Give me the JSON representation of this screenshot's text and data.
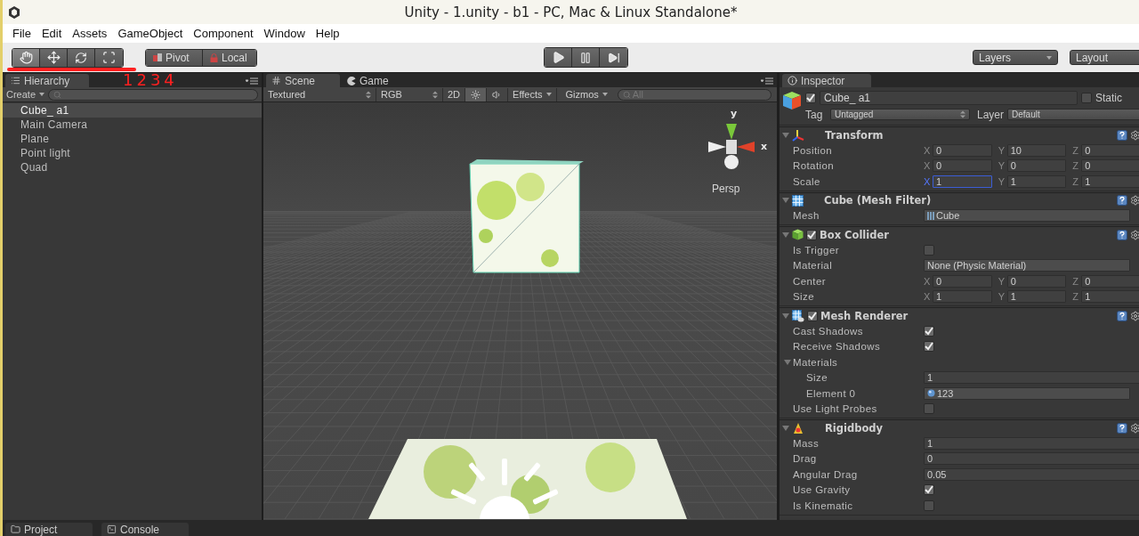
{
  "window": {
    "title": "Unity - 1.unity - b1 - PC, Mac & Linux Standalone*"
  },
  "menu": [
    "File",
    "Edit",
    "Assets",
    "GameObject",
    "Component",
    "Window",
    "Help"
  ],
  "toolbar": {
    "tools": [
      {
        "kind": "hand",
        "selected": true
      },
      {
        "kind": "move",
        "selected": false
      },
      {
        "kind": "rotate",
        "selected": false
      },
      {
        "kind": "scale",
        "selected": false
      }
    ],
    "pivot": "Pivot",
    "local": "Local",
    "playback": [
      {
        "kind": "play"
      },
      {
        "kind": "pause"
      },
      {
        "kind": "step"
      }
    ],
    "layers": "Layers",
    "layout": "Layout"
  },
  "annotation": {
    "text": "1234"
  },
  "hierarchy": {
    "tab": "Hierarchy",
    "create": "Create",
    "items": [
      {
        "label": "Cube_ a1",
        "selected": true
      },
      {
        "label": "Main Camera",
        "selected": false
      },
      {
        "label": "Plane",
        "selected": false
      },
      {
        "label": "Point light",
        "selected": false
      },
      {
        "label": "Quad",
        "selected": false
      }
    ]
  },
  "scene": {
    "tabs": [
      {
        "label": "Scene",
        "kind": "scene",
        "selected": true
      },
      {
        "label": "Game",
        "kind": "game",
        "selected": false
      }
    ],
    "toolbar": {
      "draw_mode": "Textured",
      "render_mode": "RGB",
      "mode_2d": {
        "label": "2D",
        "on": false
      },
      "lighting_on": true,
      "audio_on": false,
      "effects": "Effects",
      "gizmos": "Gizmos",
      "search_placeholder": "All"
    },
    "gizmo": {
      "y_label": "y",
      "x_label": "x",
      "projection": "Persp"
    }
  },
  "inspector": {
    "tab": "Inspector",
    "object": {
      "active": true,
      "name": "Cube_ a1",
      "static_label": "Static",
      "static": false,
      "tag_label": "Tag",
      "tag": "Untagged",
      "layer_label": "Layer",
      "layer": "Default"
    },
    "components": [
      {
        "kind": "transform",
        "title": "Transform",
        "expanded": true,
        "rows": [
          {
            "kind": "vector",
            "label": "Position",
            "values": [
              {
                "axis": "X",
                "value": "0",
                "focused": false
              },
              {
                "axis": "Y",
                "value": "10",
                "focused": false
              },
              {
                "axis": "Z",
                "value": "0",
                "focused": false
              }
            ]
          },
          {
            "kind": "vector",
            "label": "Rotation",
            "values": [
              {
                "axis": "X",
                "value": "0",
                "focused": false
              },
              {
                "axis": "Y",
                "value": "0",
                "focused": false
              },
              {
                "axis": "Z",
                "value": "0",
                "focused": false
              }
            ]
          },
          {
            "kind": "vector",
            "label": "Scale",
            "values": [
              {
                "axis": "X",
                "value": "1",
                "focused": true
              },
              {
                "axis": "Y",
                "value": "1",
                "focused": false
              },
              {
                "axis": "Z",
                "value": "1",
                "focused": false
              }
            ]
          }
        ]
      },
      {
        "kind": "mesh_filter",
        "title": "Cube (Mesh Filter)",
        "expanded": true,
        "rows": [
          {
            "kind": "mesh",
            "label": "Mesh",
            "value": "Cube"
          }
        ]
      },
      {
        "kind": "box_collider",
        "title": "Box Collider",
        "enabled": true,
        "expanded": true,
        "rows": [
          {
            "kind": "checkbox",
            "label": "Is Trigger",
            "checked": false
          },
          {
            "kind": "object",
            "label": "Material",
            "value": "None (Physic Material)"
          },
          {
            "kind": "vector",
            "label": "Center",
            "values": [
              {
                "axis": "X",
                "value": "0",
                "focused": false
              },
              {
                "axis": "Y",
                "value": "0",
                "focused": false
              },
              {
                "axis": "Z",
                "value": "0",
                "focused": false
              }
            ]
          },
          {
            "kind": "vector",
            "label": "Size",
            "values": [
              {
                "axis": "X",
                "value": "1",
                "focused": false
              },
              {
                "axis": "Y",
                "value": "1",
                "focused": false
              },
              {
                "axis": "Z",
                "value": "1",
                "focused": false
              }
            ]
          }
        ]
      },
      {
        "kind": "mesh_renderer",
        "title": "Mesh Renderer",
        "enabled": true,
        "expanded": true,
        "rows": [
          {
            "kind": "checkbox",
            "label": "Cast Shadows",
            "checked": true
          },
          {
            "kind": "checkbox",
            "label": "Receive Shadows",
            "checked": true
          },
          {
            "kind": "foldout",
            "label": "Materials",
            "expanded": true,
            "children": [
              {
                "kind": "number",
                "label": "Size",
                "value": "1"
              },
              {
                "kind": "material",
                "label": "Element 0",
                "value": "123"
              }
            ]
          },
          {
            "kind": "checkbox",
            "label": "Use Light Probes",
            "checked": false
          }
        ]
      },
      {
        "kind": "rigidbody",
        "title": "Rigidbody",
        "expanded": true,
        "rows": [
          {
            "kind": "number",
            "label": "Mass",
            "value": "1"
          },
          {
            "kind": "number",
            "label": "Drag",
            "value": "0"
          },
          {
            "kind": "number",
            "label": "Angular Drag",
            "value": "0.05"
          },
          {
            "kind": "checkbox",
            "label": "Use Gravity",
            "checked": true
          },
          {
            "kind": "checkbox",
            "label": "Is Kinematic",
            "checked": false
          }
        ]
      }
    ]
  },
  "bottom_tabs": [
    {
      "label": "Project",
      "kind": "project",
      "selected": false
    },
    {
      "label": "Console",
      "kind": "console",
      "selected": false
    }
  ]
}
